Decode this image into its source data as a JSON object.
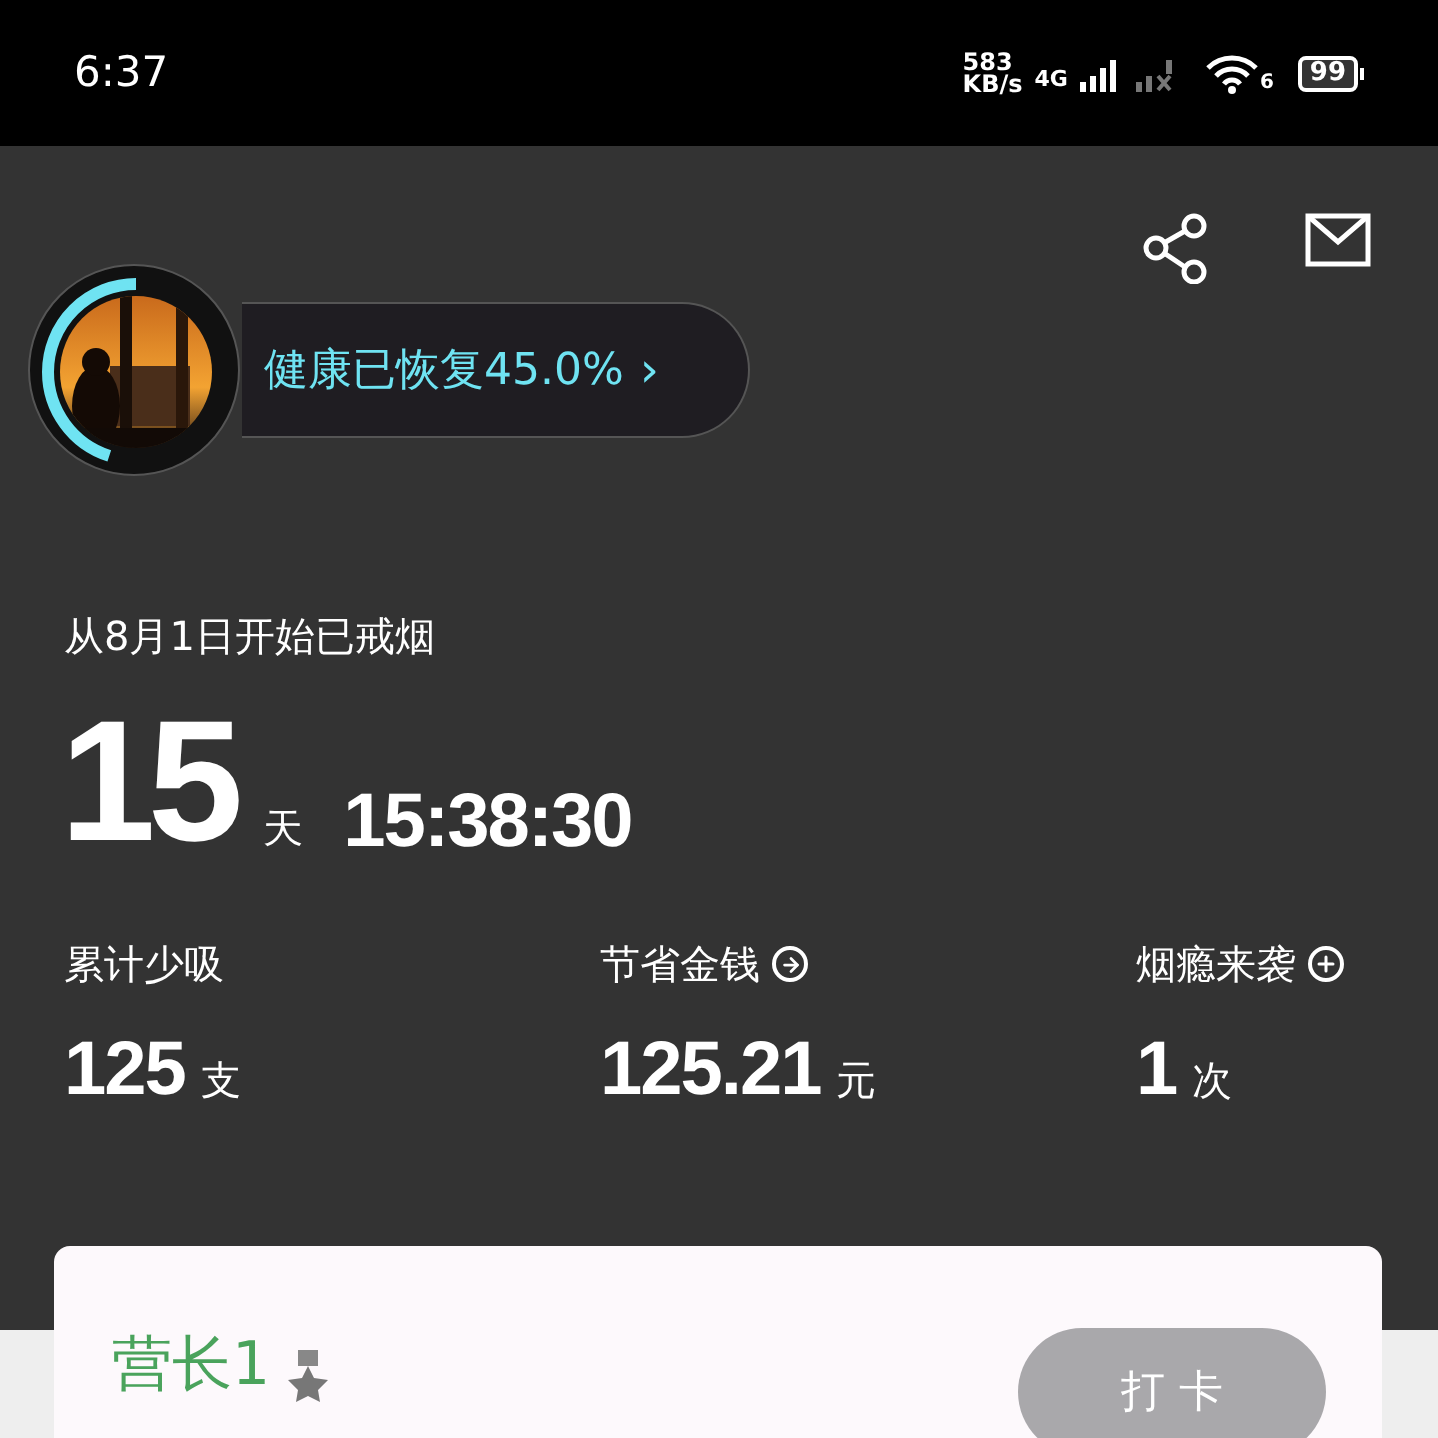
{
  "status_bar": {
    "time": "6:37",
    "speed": "583",
    "speed_unit": "KB/s",
    "network": "4G",
    "wifi_badge": "6",
    "battery": "99"
  },
  "health": {
    "label": "健康已恢复45.0%",
    "arrow": "›",
    "level": 0.45
  },
  "quit_since": "从8月1日开始已戒烟",
  "duration": {
    "days": "15",
    "days_unit": "天",
    "time": "15:38:30"
  },
  "stats": [
    {
      "label": "累计少吸",
      "value": "125",
      "unit": "支",
      "kind": "plain"
    },
    {
      "label": "节省金钱",
      "value": "125.21",
      "unit": "元",
      "kind": "arrow"
    },
    {
      "label": "烟瘾来袭",
      "value": "1",
      "unit": "次",
      "kind": "plus"
    }
  ],
  "card": {
    "title": "营长1",
    "button": "打 卡"
  }
}
